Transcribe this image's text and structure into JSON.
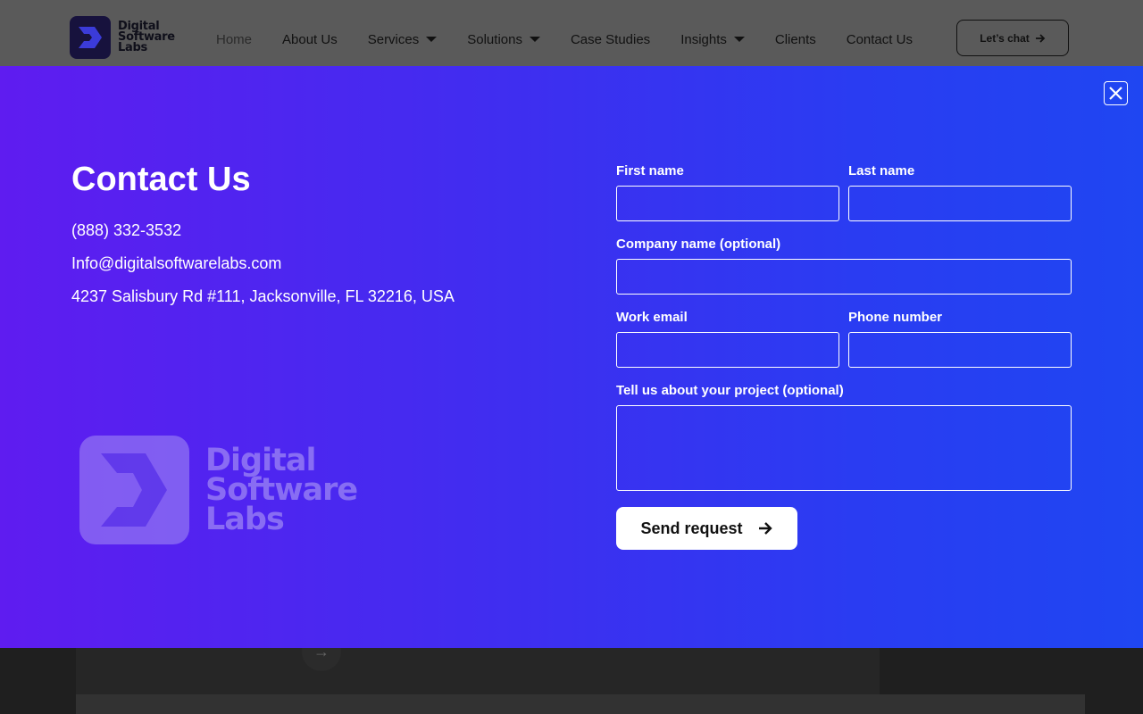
{
  "header": {
    "logo_lines": [
      "Digital",
      "Software",
      "Labs"
    ],
    "nav": [
      {
        "label": "Home",
        "dropdown": false
      },
      {
        "label": "About Us",
        "dropdown": false
      },
      {
        "label": "Services",
        "dropdown": true
      },
      {
        "label": "Solutions",
        "dropdown": true
      },
      {
        "label": "Case Studies",
        "dropdown": false
      },
      {
        "label": "Insights",
        "dropdown": true
      },
      {
        "label": "Clients",
        "dropdown": false
      },
      {
        "label": "Contact Us",
        "dropdown": false
      }
    ],
    "cta_label": "Let’s chat"
  },
  "modal": {
    "title": "Contact Us",
    "phone": "(888) 332-3532",
    "email": "Info@digitalsoftwarelabs.com",
    "address": "4237 Salisbury Rd #111, Jacksonville, FL 32216, USA",
    "logo_lines": [
      "Digital",
      "Software",
      "Labs"
    ],
    "form": {
      "first_name_label": "First name",
      "first_name_value": "",
      "last_name_label": "Last name",
      "last_name_value": "",
      "company_label": "Company name (optional)",
      "company_value": "",
      "work_email_label": "Work email",
      "work_email_value": "",
      "phone_label": "Phone number",
      "phone_value": "",
      "project_label": "Tell us about your project (optional)",
      "project_value": "",
      "submit_label": "Send request"
    }
  },
  "colors": {
    "modal_gradient_start": "#5f1cf0",
    "modal_gradient_end": "#1f46f2",
    "header_bg": "#5a5a5a"
  }
}
